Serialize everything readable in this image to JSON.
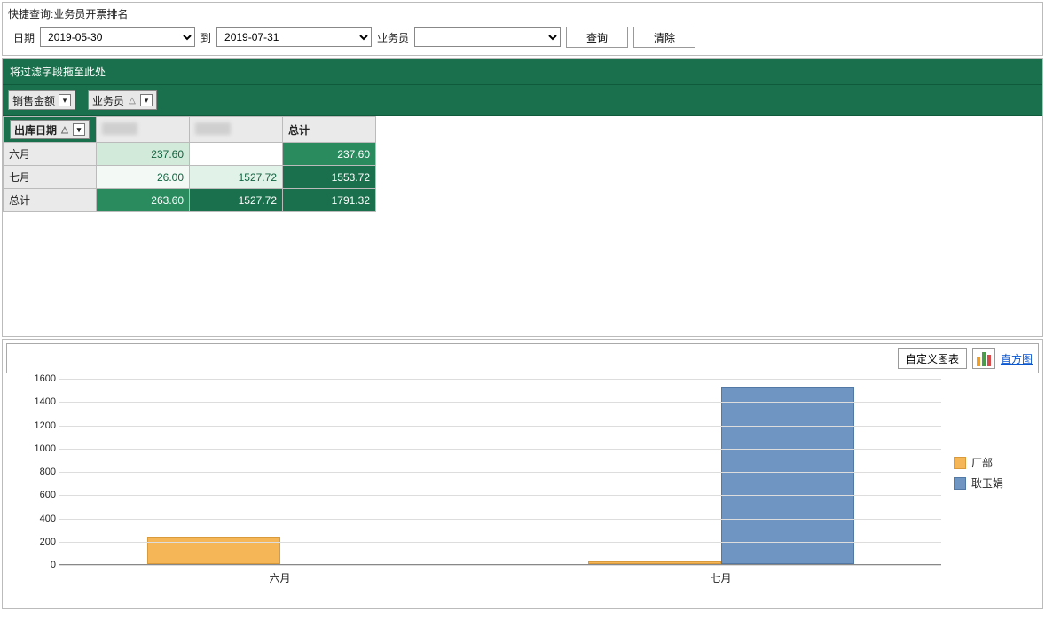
{
  "query": {
    "title": "快捷查询:业务员开票排名",
    "date_label": "日期",
    "date_from": "2019-05-30",
    "date_to_label": "到",
    "date_to": "2019-07-31",
    "agent_label": "业务员",
    "agent_value": "",
    "btn_query": "查询",
    "btn_clear": "清除"
  },
  "pivot": {
    "filter_placeholder": "将过滤字段拖至此处",
    "measure_chip": "销售金额",
    "col_chip": "业务员",
    "row_chip": "出库日期",
    "total_label": "总计",
    "rows": [
      "六月",
      "七月",
      "总计"
    ],
    "cols": [
      "",
      "",
      "总计"
    ],
    "cells": [
      [
        "237.60",
        "",
        "237.60"
      ],
      [
        "26.00",
        "1527.72",
        "1553.72"
      ],
      [
        "263.60",
        "1527.72",
        "1791.32"
      ]
    ]
  },
  "chart_toolbar": {
    "customize": "自定义图表",
    "histogram_link": "直方图"
  },
  "chart_data": {
    "type": "bar",
    "categories": [
      "六月",
      "七月"
    ],
    "series": [
      {
        "name": "厂部",
        "values": [
          237.6,
          26.0
        ],
        "color": "#f4b657"
      },
      {
        "name": "耿玉娟",
        "values": [
          0,
          1527.72
        ],
        "color": "#6f95c3"
      }
    ],
    "ylim": [
      0,
      1600
    ],
    "ystep": 200,
    "title": "",
    "xlabel": "",
    "ylabel": ""
  }
}
